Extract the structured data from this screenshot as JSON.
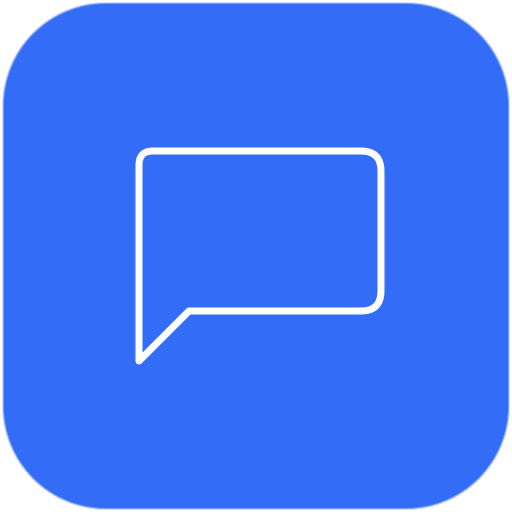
{
  "app_icon": {
    "icon": "chat-bubble-icon",
    "background_color": "#336CF6",
    "glyph_color": "#FFFFFF"
  }
}
